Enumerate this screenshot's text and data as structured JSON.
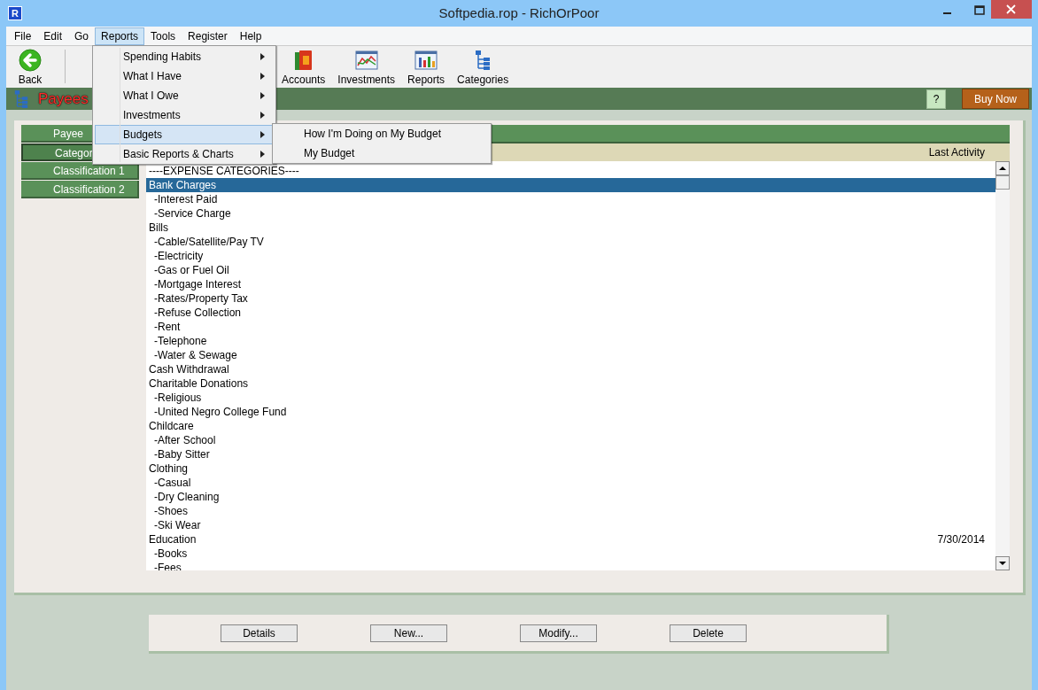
{
  "window": {
    "title": "Softpedia.rop - RichOrPoor",
    "icon_letter": "R"
  },
  "menu_bar": [
    {
      "label": "File",
      "selected": false
    },
    {
      "label": "Edit",
      "selected": false
    },
    {
      "label": "Go",
      "selected": false
    },
    {
      "label": "Reports",
      "selected": true
    },
    {
      "label": "Tools",
      "selected": false
    },
    {
      "label": "Register",
      "selected": false
    },
    {
      "label": "Help",
      "selected": false
    }
  ],
  "open_menu": {
    "items": [
      {
        "label": "Spending Habits",
        "selected": false
      },
      {
        "label": "What I Have",
        "selected": false
      },
      {
        "label": "What I Owe",
        "selected": false
      },
      {
        "label": "Investments",
        "selected": false
      },
      {
        "label": "Budgets",
        "selected": true
      },
      {
        "label": "Basic Reports & Charts",
        "selected": false
      }
    ]
  },
  "submenu": {
    "items": [
      "How I'm Doing on My Budget",
      "My Budget"
    ]
  },
  "toolbar": [
    {
      "label": "Back",
      "kind": "back"
    },
    {
      "label": "Accounts",
      "kind": "accounts"
    },
    {
      "label": "Investments",
      "kind": "investments"
    },
    {
      "label": "Reports",
      "kind": "reports"
    },
    {
      "label": "Categories",
      "kind": "categories"
    }
  ],
  "header": {
    "title": "Payees",
    "help_button": "?",
    "buy_button": "Buy Now"
  },
  "side_tabs": [
    {
      "label": "Payee",
      "selected": false
    },
    {
      "label": "Categor",
      "selected": true
    },
    {
      "label": "Classification 1",
      "selected": false
    },
    {
      "label": "Classification 2",
      "selected": false
    }
  ],
  "list": {
    "columns": [
      "Last Activity"
    ],
    "rows": [
      {
        "label": "----EXPENSE CATEGORIES----",
        "selected": false
      },
      {
        "label": "Bank Charges",
        "selected": true,
        "children": [
          {
            "label": "-Interest Paid",
            "selected": false
          },
          {
            "label": "-Service Charge",
            "selected": false
          }
        ]
      },
      {
        "label": "Bills",
        "selected": false,
        "children": [
          {
            "label": "-Cable/Satellite/Pay TV",
            "selected": false
          },
          {
            "label": "-Electricity",
            "selected": false
          },
          {
            "label": "-Gas or Fuel Oil",
            "selected": false
          },
          {
            "label": "-Mortgage Interest",
            "selected": false
          },
          {
            "label": "-Rates/Property Tax",
            "selected": false
          },
          {
            "label": "-Refuse Collection",
            "selected": false
          },
          {
            "label": "-Rent",
            "selected": false
          },
          {
            "label": "-Telephone",
            "selected": false
          },
          {
            "label": "-Water & Sewage",
            "selected": false
          }
        ]
      },
      {
        "label": "Cash Withdrawal",
        "selected": false
      },
      {
        "label": "Charitable Donations",
        "selected": false,
        "children": [
          {
            "label": "-Religious",
            "selected": false
          },
          {
            "label": "-United Negro College Fund",
            "selected": false
          }
        ]
      },
      {
        "label": "Childcare",
        "selected": false,
        "children": [
          {
            "label": "-After School",
            "selected": false
          },
          {
            "label": "-Baby Sitter",
            "selected": false
          }
        ]
      },
      {
        "label": "Clothing",
        "selected": false,
        "children": [
          {
            "label": "-Casual",
            "selected": false
          },
          {
            "label": "-Dry Cleaning",
            "selected": false
          },
          {
            "label": "-Shoes",
            "selected": false
          },
          {
            "label": "-Ski Wear",
            "selected": false
          }
        ]
      },
      {
        "label": "Education",
        "selected": false,
        "last_activity": "7/30/2014",
        "children": [
          {
            "label": "-Books",
            "selected": false
          },
          {
            "label": "-Fees",
            "selected": false
          }
        ]
      }
    ]
  },
  "buttons": [
    "Details",
    "New...",
    "Modify...",
    "Delete"
  ]
}
